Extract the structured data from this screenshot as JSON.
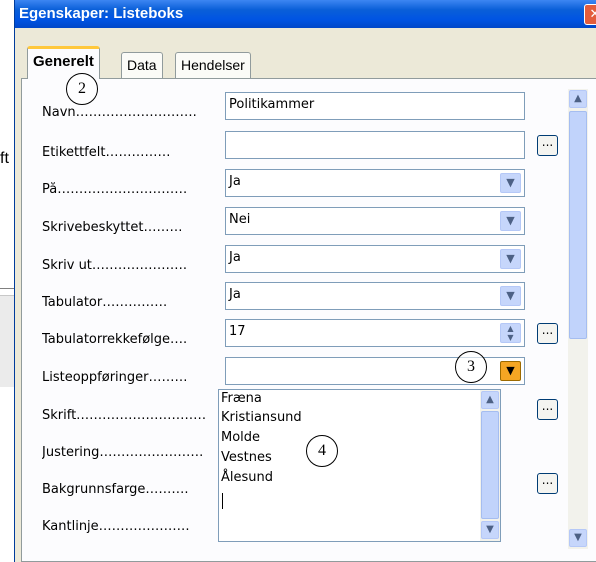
{
  "background": {
    "fragment_text": "ft"
  },
  "dialog": {
    "title": "Egenskaper: Listeboks",
    "close_glyph": "✕"
  },
  "tabs": [
    "Generelt",
    "Data",
    "Hendelser"
  ],
  "properties": [
    {
      "label": "Navn……………………….",
      "value": "Politikammer",
      "kind": "text"
    },
    {
      "label": "Etikettfelt……………",
      "value": "",
      "kind": "text-button"
    },
    {
      "label": "På…………………………",
      "value": "Ja",
      "kind": "combo"
    },
    {
      "label": "Skrivebeskyttet………",
      "value": "Nei",
      "kind": "combo"
    },
    {
      "label": "Skriv ut………………….",
      "value": "Ja",
      "kind": "combo"
    },
    {
      "label": "Tabulator……………",
      "value": "Ja",
      "kind": "combo"
    },
    {
      "label": "Tabulatorrekkefølge….",
      "value": "17",
      "kind": "spin-button"
    },
    {
      "label": "Listeoppføringer………",
      "value": "",
      "kind": "combo-open"
    },
    {
      "label": "Skrift…………………………",
      "value": "",
      "kind": "button"
    },
    {
      "label": "Justering……………………",
      "value": "",
      "kind": "none"
    },
    {
      "label": "Bakgrunnsfarge……….",
      "value": "",
      "kind": "button"
    },
    {
      "label": "Kantlinje…………………",
      "value": "",
      "kind": "none"
    }
  ],
  "dropdown": {
    "items": [
      "Fræna",
      "Kristiansund",
      "Molde",
      "Vestnes",
      "Ålesund"
    ]
  },
  "buttons": {
    "ellipsis": "..."
  },
  "callouts": [
    "2",
    "3",
    "4"
  ],
  "icons": {
    "combo": "▼",
    "scroll_up": "▲",
    "scroll_down": "▼"
  }
}
